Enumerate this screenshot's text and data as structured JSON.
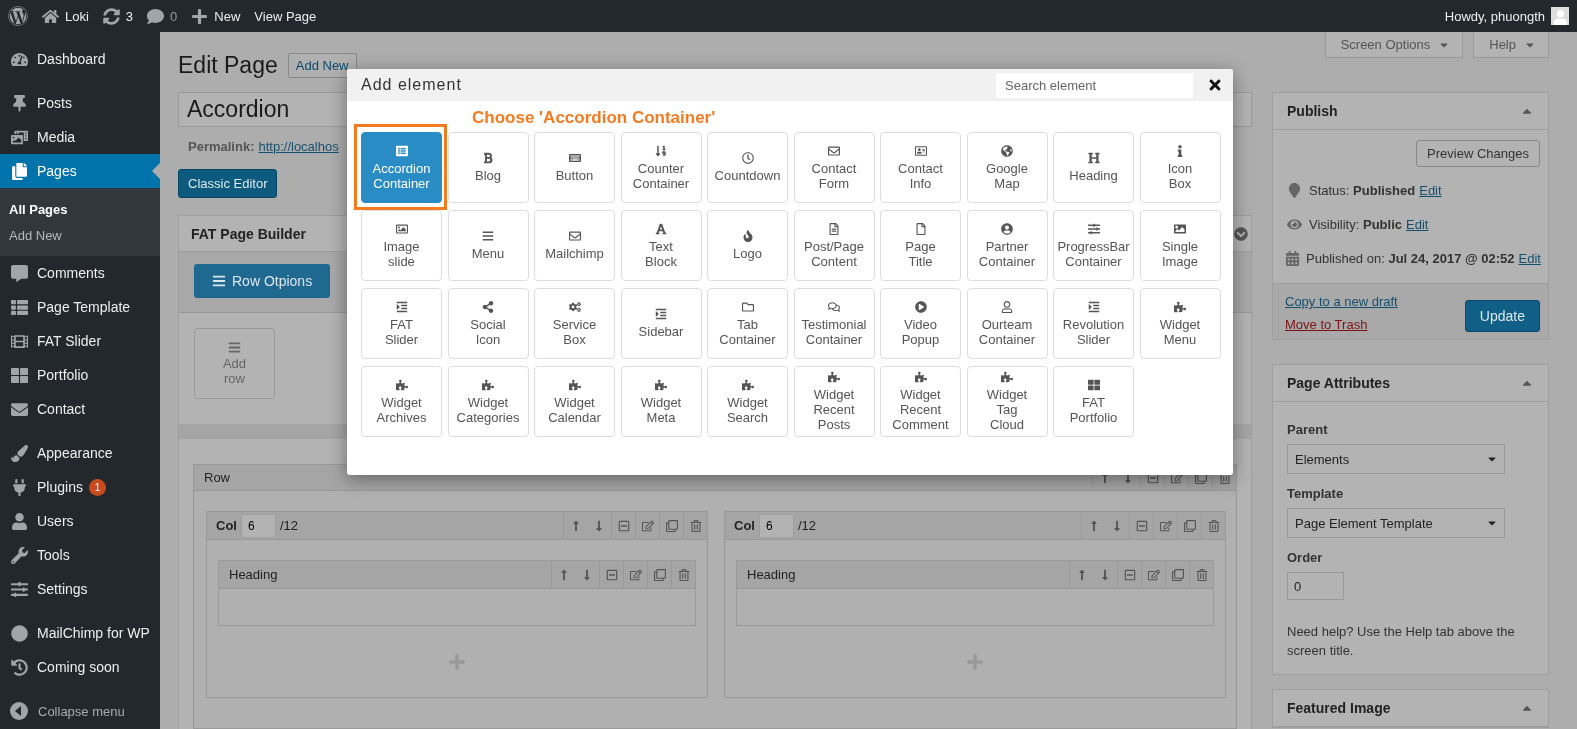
{
  "admin_bar": {
    "site_name": "Loki",
    "updates": "3",
    "comments": "0",
    "new_label": "New",
    "view_label": "View Page",
    "greeting": "Howdy, phuongth"
  },
  "sidebar": {
    "groups": [
      [
        {
          "label": "Dashboard",
          "selected": false
        }
      ],
      [
        {
          "label": "Posts",
          "selected": false
        },
        {
          "label": "Media",
          "selected": false
        },
        {
          "label": "Pages",
          "selected": true,
          "children": [
            {
              "label": "All Pages",
              "selected": true
            },
            {
              "label": "Add New",
              "selected": false
            }
          ]
        },
        {
          "label": "Comments",
          "selected": false
        },
        {
          "label": "Page Template",
          "selected": false
        },
        {
          "label": "FAT Slider",
          "selected": false
        },
        {
          "label": "Portfolio",
          "selected": false
        },
        {
          "label": "Contact",
          "selected": false
        }
      ],
      [
        {
          "label": "Appearance",
          "selected": false
        },
        {
          "label": "Plugins",
          "selected": false,
          "badge": "1"
        },
        {
          "label": "Users",
          "selected": false
        },
        {
          "label": "Tools",
          "selected": false
        },
        {
          "label": "Settings",
          "selected": false
        }
      ],
      [
        {
          "label": "MailChimp for WP",
          "selected": false
        },
        {
          "label": "Coming soon",
          "selected": false
        }
      ]
    ],
    "collapse_label": "Collapse menu"
  },
  "screen_tabs": [
    {
      "label": "Screen Options"
    },
    {
      "label": "Help"
    }
  ],
  "editor": {
    "heading": "Edit Page",
    "add_new": "Add New",
    "title_value": "Accordion",
    "permalink_label": "Permalink:",
    "permalink_url": "http://localhos",
    "classic_editor": "Classic Editor"
  },
  "builder": {
    "title": "FAT Page Builder",
    "row_options": "Row Otpions",
    "add_row": "Add row",
    "rows": [
      {
        "label": "Row",
        "columns": [
          {
            "label": "Col",
            "span": "6",
            "total": "/12",
            "elements": [
              {
                "label": "Heading"
              }
            ]
          },
          {
            "label": "Col",
            "span": "6",
            "total": "/12",
            "elements": [
              {
                "label": "Heading"
              }
            ]
          }
        ]
      }
    ]
  },
  "publish": {
    "title": "Publish",
    "preview": "Preview Changes",
    "meta": [
      {
        "kind": "status",
        "label": "Status:",
        "value": "Published",
        "link": "Edit"
      },
      {
        "kind": "visibility",
        "label": "Visibility:",
        "value": "Public",
        "link": "Edit"
      },
      {
        "kind": "date",
        "label": "Published on:",
        "value": "Jul 24, 2017 @ 02:52",
        "link": "Edit"
      }
    ],
    "copy_link": "Copy to a new draft",
    "trash_link": "Move to Trash",
    "update": "Update"
  },
  "page_attributes": {
    "title": "Page Attributes",
    "fields": [
      {
        "kind": "select",
        "label": "Parent",
        "value": "Elements"
      },
      {
        "kind": "select",
        "label": "Template",
        "value": "Page Element Template"
      },
      {
        "kind": "input",
        "label": "Order",
        "value": "0"
      }
    ],
    "help": "Need help? Use the Help tab above the screen title."
  },
  "featured_image": {
    "title": "Featured Image"
  },
  "modal": {
    "title": "Add element",
    "search_placeholder": "Search element",
    "annotation": "Choose 'Accordion Container'",
    "elements": [
      {
        "label": "Accordion Container",
        "selected": true
      },
      {
        "label": "Blog",
        "selected": false
      },
      {
        "label": "Button",
        "selected": false
      },
      {
        "label": "Counter Container",
        "selected": false
      },
      {
        "label": "Countdown",
        "selected": false
      },
      {
        "label": "Contact Form",
        "selected": false
      },
      {
        "label": "Contact Info",
        "selected": false
      },
      {
        "label": "Google Map",
        "selected": false
      },
      {
        "label": "Heading",
        "selected": false
      },
      {
        "label": "Icon Box",
        "selected": false
      },
      {
        "label": "Image slide",
        "selected": false
      },
      {
        "label": "Menu",
        "selected": false
      },
      {
        "label": "Mailchimp",
        "selected": false
      },
      {
        "label": "Text Block",
        "selected": false
      },
      {
        "label": "Logo",
        "selected": false
      },
      {
        "label": "Post/Page Content",
        "selected": false
      },
      {
        "label": "Page Title",
        "selected": false
      },
      {
        "label": "Partner Container",
        "selected": false
      },
      {
        "label": "ProgressBar Container",
        "selected": false
      },
      {
        "label": "Single Image",
        "selected": false
      },
      {
        "label": "FAT Slider",
        "selected": false
      },
      {
        "label": "Social Icon",
        "selected": false
      },
      {
        "label": "Service Box",
        "selected": false
      },
      {
        "label": "Sidebar",
        "selected": false
      },
      {
        "label": "Tab Container",
        "selected": false
      },
      {
        "label": "Testimonial Container",
        "selected": false
      },
      {
        "label": "Video Popup",
        "selected": false
      },
      {
        "label": "Ourteam Container",
        "selected": false
      },
      {
        "label": "Revolution Slider",
        "selected": false
      },
      {
        "label": "Widget Menu",
        "selected": false
      },
      {
        "label": "Widget Archives",
        "selected": false
      },
      {
        "label": "Widget Categories",
        "selected": false
      },
      {
        "label": "Widget Calendar",
        "selected": false
      },
      {
        "label": "Widget Meta",
        "selected": false
      },
      {
        "label": "Widget Search",
        "selected": false
      },
      {
        "label": "Widget Recent Posts",
        "selected": false
      },
      {
        "label": "Widget Recent Comment",
        "selected": false
      },
      {
        "label": "Widget Tag Cloud",
        "selected": false
      },
      {
        "label": "FAT Portfolio",
        "selected": false
      }
    ]
  }
}
